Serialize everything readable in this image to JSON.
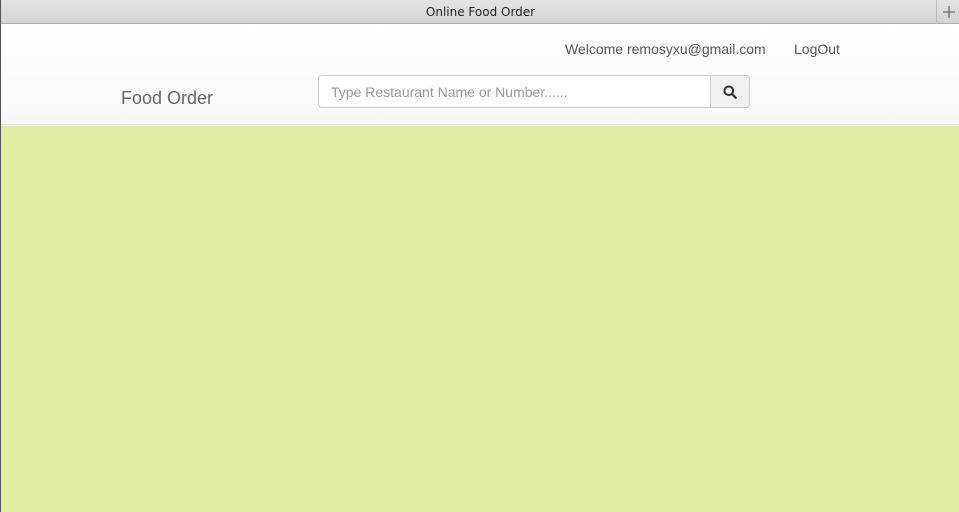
{
  "window": {
    "title": "Online Food Order"
  },
  "header": {
    "welcome_text": "Welcome remosyxu@gmail.com",
    "logout_label": "LogOut",
    "brand": "Food Order"
  },
  "search": {
    "placeholder": "Type Restaurant Name or Number......",
    "value": "",
    "button_icon": "search-icon"
  },
  "theme": {
    "content_background": "#e5eca6"
  }
}
